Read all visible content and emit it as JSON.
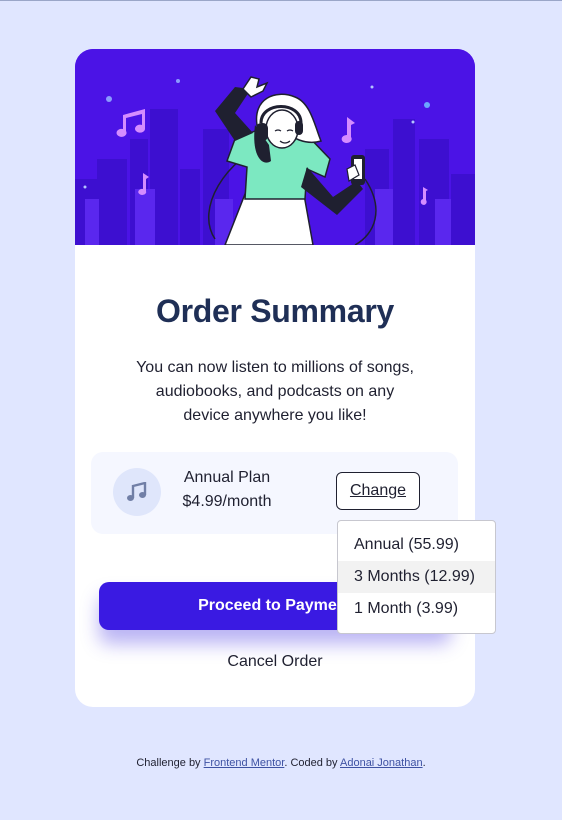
{
  "hero": {
    "illustration": "person-dancing-with-headphones-illustration"
  },
  "card": {
    "title": "Order Summary",
    "description": "You can now listen to millions of songs, audiobooks, and podcasts on any device anywhere you like!"
  },
  "plan": {
    "icon": "music-note-icon",
    "name": "Annual Plan",
    "price": "$4.99/month",
    "change_label": "Change"
  },
  "dropdown": {
    "options": [
      "Annual (55.99)",
      "3 Months (12.99)",
      "1 Month (3.99)"
    ],
    "highlighted_option": "3 Months (12.99)"
  },
  "actions": {
    "proceed_label": "Proceed to Payment",
    "cancel_label": "Cancel Order"
  },
  "footer": {
    "prefix": "Challenge by ",
    "frontend_mentor_link": "Frontend Mentor",
    "middle": ". Coded by ",
    "author_link": "Adonai Jonathan",
    "suffix": "."
  },
  "colors": {
    "page_background": "#e0e6ff",
    "hero_background": "#4b13e6",
    "primary_button": "#3a1ae2",
    "title_text": "#1f2f56",
    "link": "#3e52a3"
  }
}
